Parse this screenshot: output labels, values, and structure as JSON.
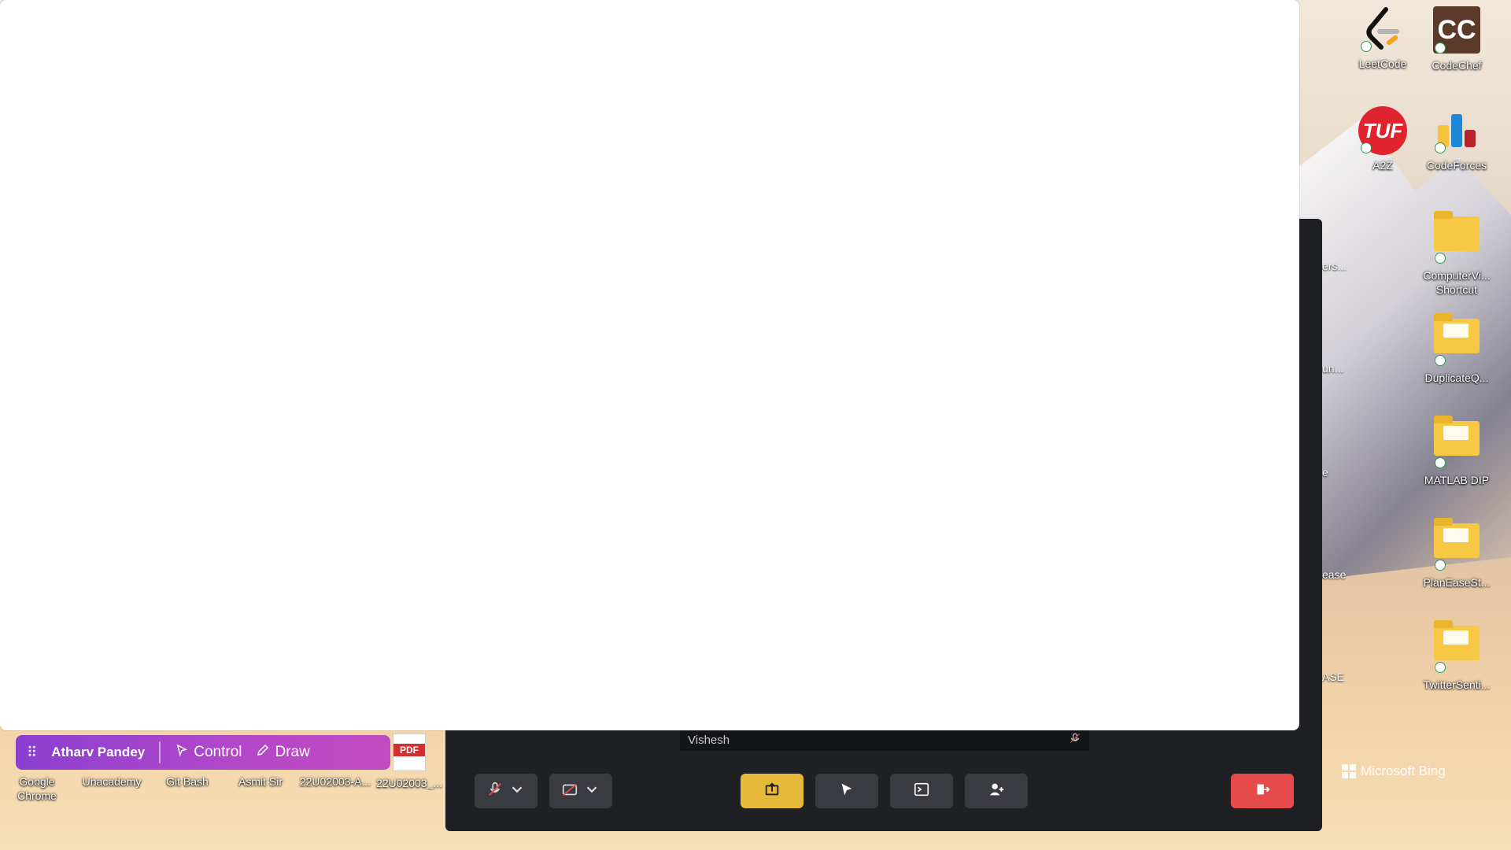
{
  "desktop": {
    "icons_right": [
      {
        "id": "leetcode",
        "label": "LeetCode"
      },
      {
        "id": "codechef",
        "label": "CodeChef"
      },
      {
        "id": "a2z",
        "label": "A2Z"
      },
      {
        "id": "codeforces",
        "label": "CodeForces"
      },
      {
        "id": "computervi",
        "label": "ComputerVi... Shortcut"
      },
      {
        "id": "duplicateq",
        "label": "DuplicateQ..."
      },
      {
        "id": "matlabdip",
        "label": "MATLAB DIP"
      },
      {
        "id": "planease",
        "label": "PlanEaseSt..."
      },
      {
        "id": "twittersenti",
        "label": "TwitterSenti..."
      }
    ],
    "partial_labels": [
      "ers...",
      "un...",
      "e",
      "ease",
      "ASE"
    ],
    "icons_bottom": [
      {
        "id": "chrome",
        "label": "Google Chrome"
      },
      {
        "id": "unacademy",
        "label": "Unacademy"
      },
      {
        "id": "gitbash",
        "label": "Git Bash"
      },
      {
        "id": "asmitsir",
        "label": "Asmit Sir"
      },
      {
        "id": "doc22u1",
        "label": "22U02003-A..."
      },
      {
        "id": "pdf22u2",
        "label": "22U02003_..."
      }
    ],
    "bing_text": "Microsoft Bing",
    "codechef_logo_text": "CC",
    "tuf_logo_text": "TUF",
    "pdf_badge_text": "PDF"
  },
  "remote_toolbar": {
    "user": "Atharv Pandey",
    "control_label": "Control",
    "draw_label": "Draw"
  },
  "meeting": {
    "participant_name": "Vishesh",
    "colors": {
      "share": "#e6b93b",
      "leave": "#e64b4b",
      "bar": "#1f2023"
    }
  }
}
